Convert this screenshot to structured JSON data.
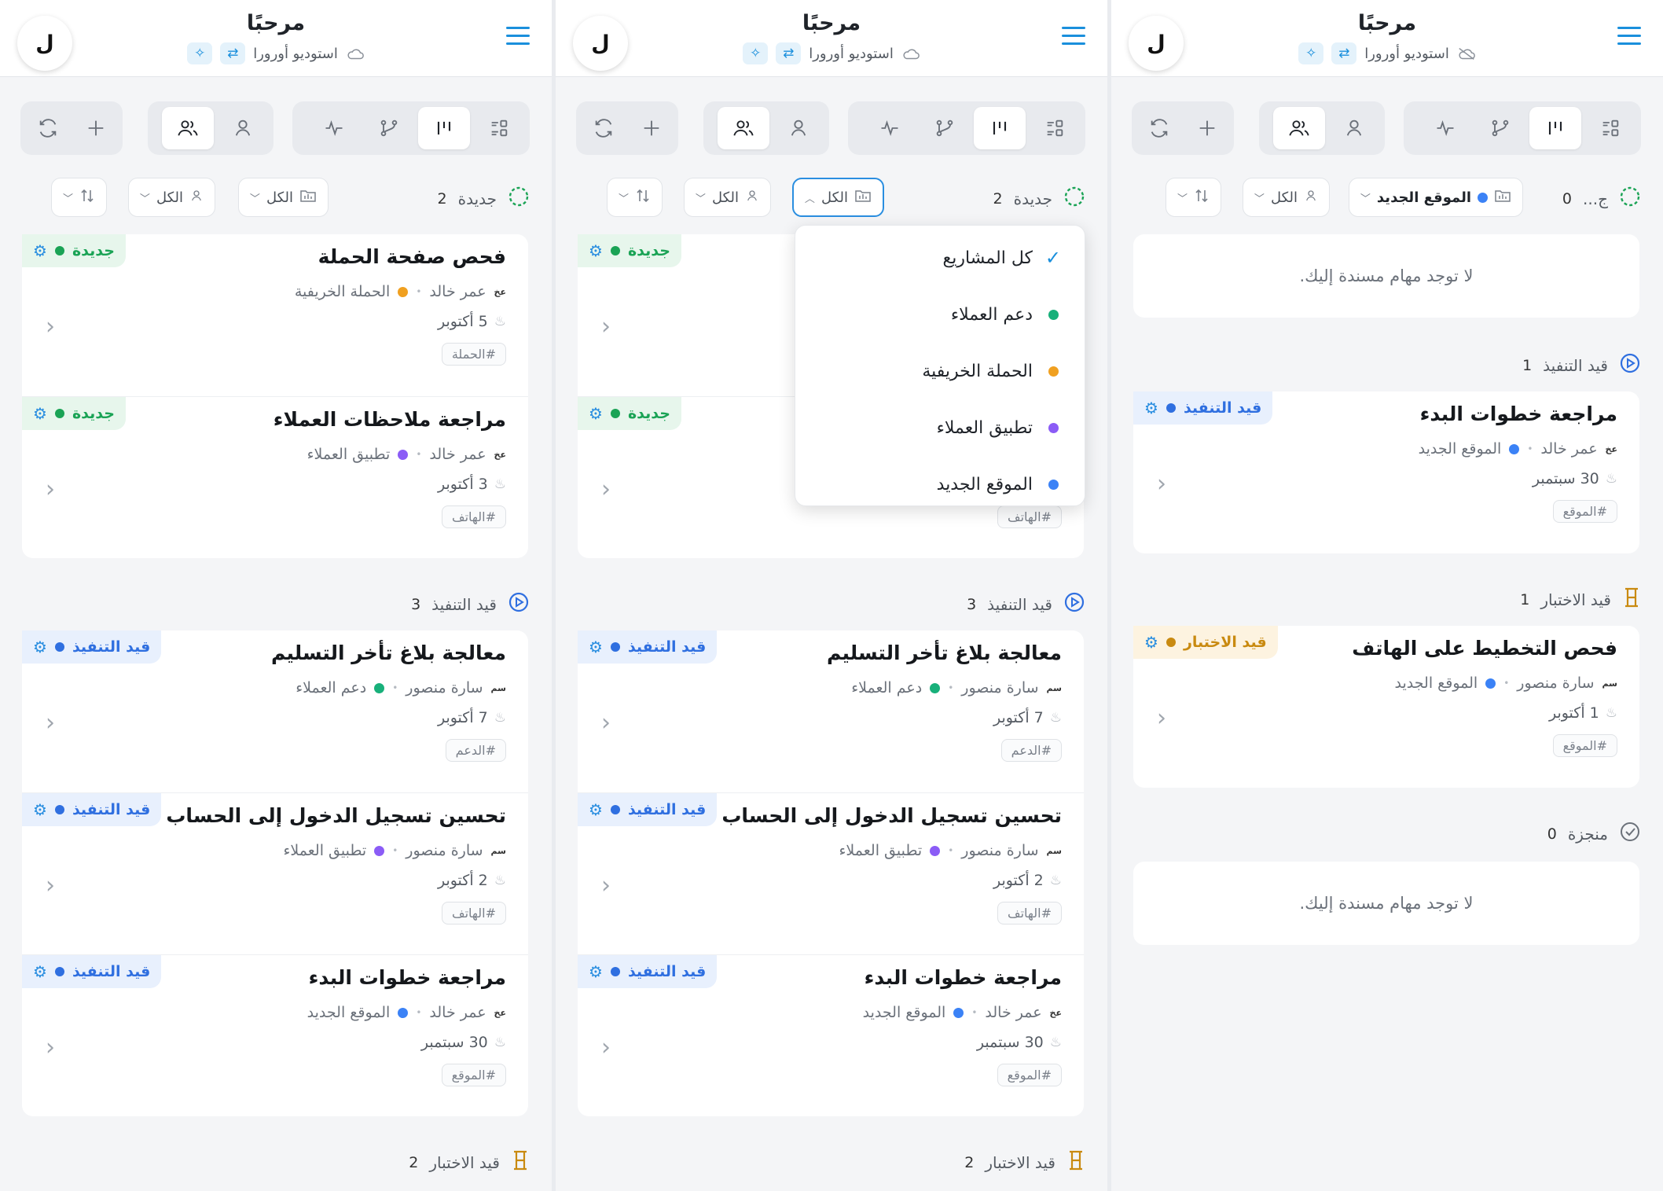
{
  "header": {
    "greeting": "مرحبًا",
    "workspace": "استوديو أورورا",
    "avatar_letter": "ل"
  },
  "filters": {
    "all_projects": "الكل",
    "all_members": "الكل",
    "selected_project": "الموقع الجديد"
  },
  "sections": {
    "new": "جديدة",
    "new_truncated": "ج...",
    "in_progress": "قيد التنفيذ",
    "testing": "قيد الاختبار",
    "done": "منجزة"
  },
  "counts": {
    "new": "2",
    "in_progress": "3",
    "testing": "2",
    "p3_new": "0",
    "p3_in_progress": "1",
    "p3_testing": "1",
    "p3_done": "0"
  },
  "empty_text": "لا توجد مهام مسندة إليك.",
  "dropdown": {
    "options": [
      "كل المشاريع",
      "دعم العملاء",
      "الحملة الخريفية",
      "تطبيق العملاء",
      "الموقع الجديد"
    ]
  },
  "colors": {
    "accent": "#1a8fdc",
    "new": "#1aa355",
    "in_progress": "#2f6fe0",
    "testing": "#c98a10",
    "support": "#18b07a",
    "campaign": "#f0a020",
    "app": "#8b5cf6",
    "site": "#3b82f6"
  },
  "tasks": [
    {
      "title": "فحص صفحة الحملة",
      "initials": "عخ",
      "assignee": "عمر خالد",
      "project": "الحملة الخريفية",
      "date": "5 أكتوبر",
      "tag": "#الحملة",
      "status": "جديدة"
    },
    {
      "title": "مراجعة ملاحظات العملاء",
      "initials": "عخ",
      "assignee": "عمر خالد",
      "project": "تطبيق العملاء",
      "date": "3 أكتوبر",
      "tag": "#الهاتف",
      "status": "جديدة"
    },
    {
      "title": "معالجة بلاغ تأخر التسليم",
      "initials": "سم",
      "assignee": "سارة منصور",
      "project": "دعم العملاء",
      "date": "7 أكتوبر",
      "tag": "#الدعم",
      "status": "قيد التنفيذ"
    },
    {
      "title": "تحسين تسجيل الدخول إلى الحساب",
      "initials": "سم",
      "assignee": "سارة منصور",
      "project": "تطبيق العملاء",
      "date": "2 أكتوبر",
      "tag": "#الهاتف",
      "status": "قيد التنفيذ"
    },
    {
      "title": "مراجعة خطوات البدء",
      "initials": "عخ",
      "assignee": "عمر خالد",
      "project": "الموقع الجديد",
      "date": "30 سبتمبر",
      "tag": "#الموقع",
      "status": "قيد التنفيذ"
    },
    {
      "title": "فحص التخطيط على الهاتف",
      "initials": "سم",
      "assignee": "سارة منصور",
      "project": "الموقع الجديد",
      "date": "1 أكتوبر",
      "tag": "#الموقع",
      "status": "قيد الاختبار"
    }
  ]
}
